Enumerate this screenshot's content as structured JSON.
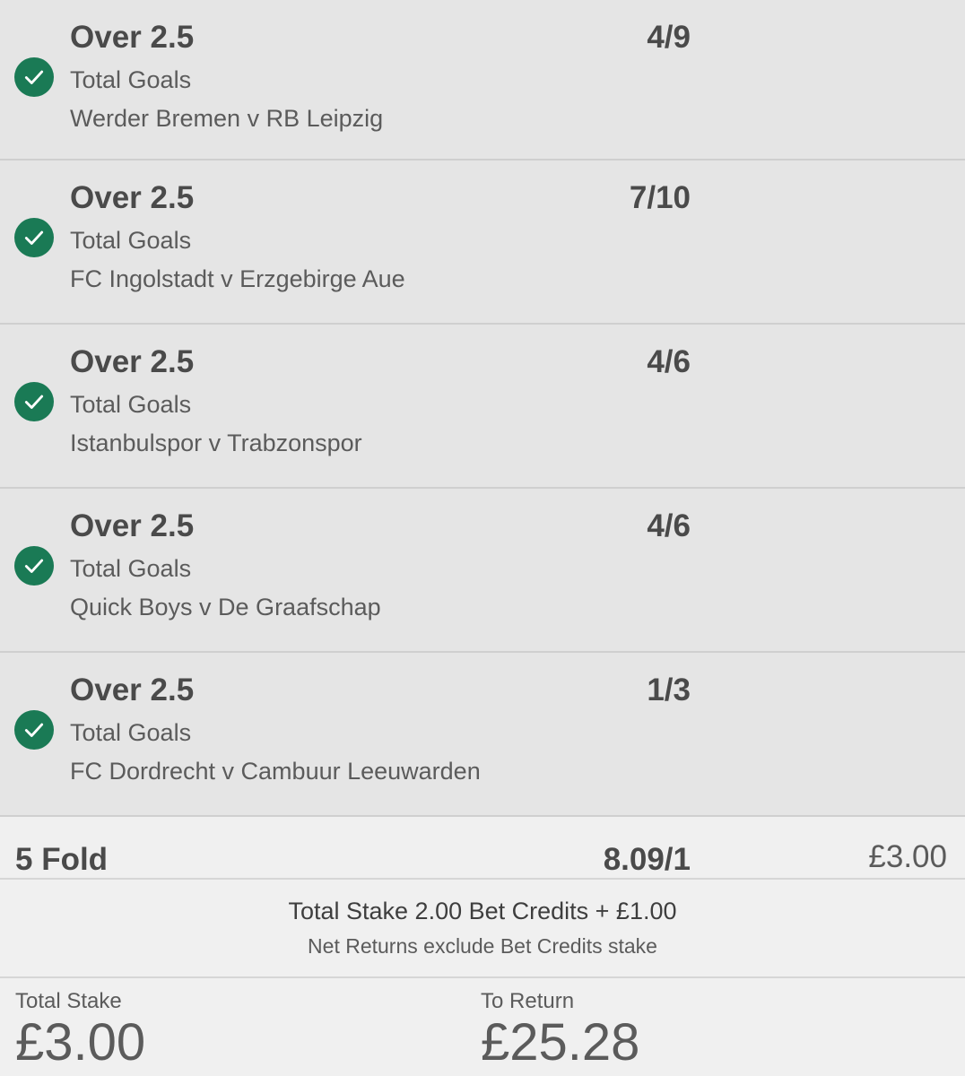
{
  "selections": [
    {
      "name": "Over 2.5",
      "odds": "4/9",
      "market": "Total Goals",
      "event": "Werder Bremen v RB Leipzig"
    },
    {
      "name": "Over 2.5",
      "odds": "7/10",
      "market": "Total Goals",
      "event": "FC Ingolstadt v Erzgebirge Aue"
    },
    {
      "name": "Over 2.5",
      "odds": "4/6",
      "market": "Total Goals",
      "event": "Istanbulspor v Trabzonspor"
    },
    {
      "name": "Over 2.5",
      "odds": "4/6",
      "market": "Total Goals",
      "event": "Quick Boys v De Graafschap"
    },
    {
      "name": "Over 2.5",
      "odds": "1/3",
      "market": "Total Goals",
      "event": "FC Dordrecht v Cambuur Leeuwarden"
    }
  ],
  "status_icon": "check-circle-icon",
  "colors": {
    "accent": "#1a7a55",
    "background": "#e5e5e5",
    "summary_bg": "#f0f0f0"
  },
  "fold": {
    "label": "5 Fold",
    "odds": "8.09/1",
    "stake": "£3.00"
  },
  "info": {
    "line1": "Total Stake 2.00 Bet Credits + £1.00",
    "line2": "Net Returns exclude Bet Credits stake"
  },
  "totals": {
    "stake_label": "Total Stake",
    "stake_value": "£3.00",
    "return_label": "To Return",
    "return_value": "£25.28"
  }
}
